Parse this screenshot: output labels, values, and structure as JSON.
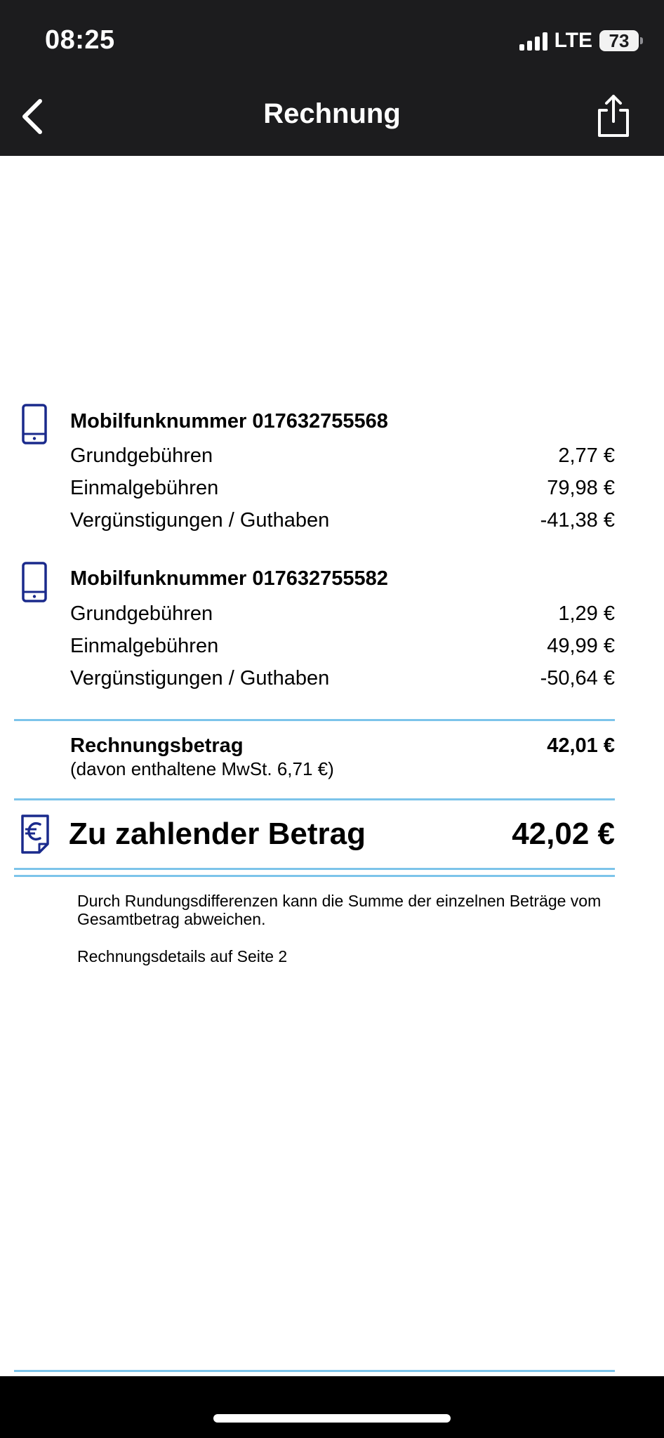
{
  "status_bar": {
    "time": "08:25",
    "network": "LTE",
    "battery": "73"
  },
  "nav": {
    "title": "Rechnung"
  },
  "accent_color": "#7cc4ea",
  "icon_color": "#1a2a8c",
  "numbers": [
    {
      "heading": "Mobilfunknummer 017632755568",
      "rows": [
        {
          "label": "Grundgebühren",
          "value": "2,77 €"
        },
        {
          "label": "Einmalgebühren",
          "value": "79,98 €"
        },
        {
          "label": "Vergünstigungen / Guthaben",
          "value": "-41,38 €"
        }
      ]
    },
    {
      "heading": "Mobilfunknummer 017632755582",
      "rows": [
        {
          "label": "Grundgebühren",
          "value": "1,29 €"
        },
        {
          "label": "Einmalgebühren",
          "value": "49,99 €"
        },
        {
          "label": "Vergünstigungen / Guthaben",
          "value": "-50,64 €"
        }
      ]
    }
  ],
  "summary": {
    "label": "Rechnungsbetrag",
    "value": "42,01 €",
    "vat": "(davon enthaltene MwSt. 6,71 €)"
  },
  "payment": {
    "label": "Zu zahlender Betrag",
    "value": "42,02 €"
  },
  "notes": {
    "rounding": "Durch Rundungsdifferenzen kann die Summe der einzelnen Beträge vom Gesamtbetrag abweichen.",
    "details": "Rechnungsdetails auf Seite 2"
  }
}
